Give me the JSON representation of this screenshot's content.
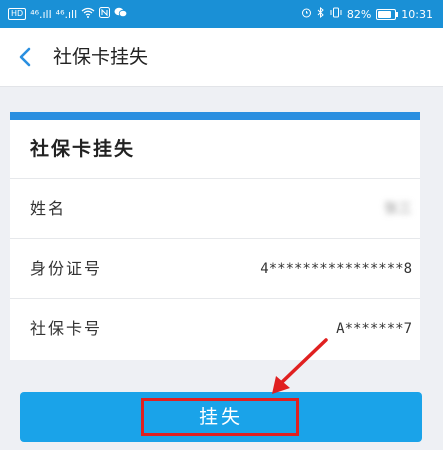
{
  "status_bar": {
    "chip": "HD",
    "signal1": "⁴⁶.ıll",
    "signal2": "⁴⁶.ıll",
    "battery": "82%",
    "battery_level": 0.82,
    "time": "10:31"
  },
  "nav": {
    "title": "社保卡挂失"
  },
  "card": {
    "title": "社保卡挂失",
    "rows": [
      {
        "label": "姓名",
        "value": "张三"
      },
      {
        "label": "身份证号",
        "value": "4****************8"
      },
      {
        "label": "社保卡号",
        "value": "A*******7"
      }
    ]
  },
  "actions": {
    "submit_label": "挂失"
  },
  "colors": {
    "accent": "#2a8fe0",
    "button": "#1aa3e9",
    "annotation": "#e02020"
  }
}
